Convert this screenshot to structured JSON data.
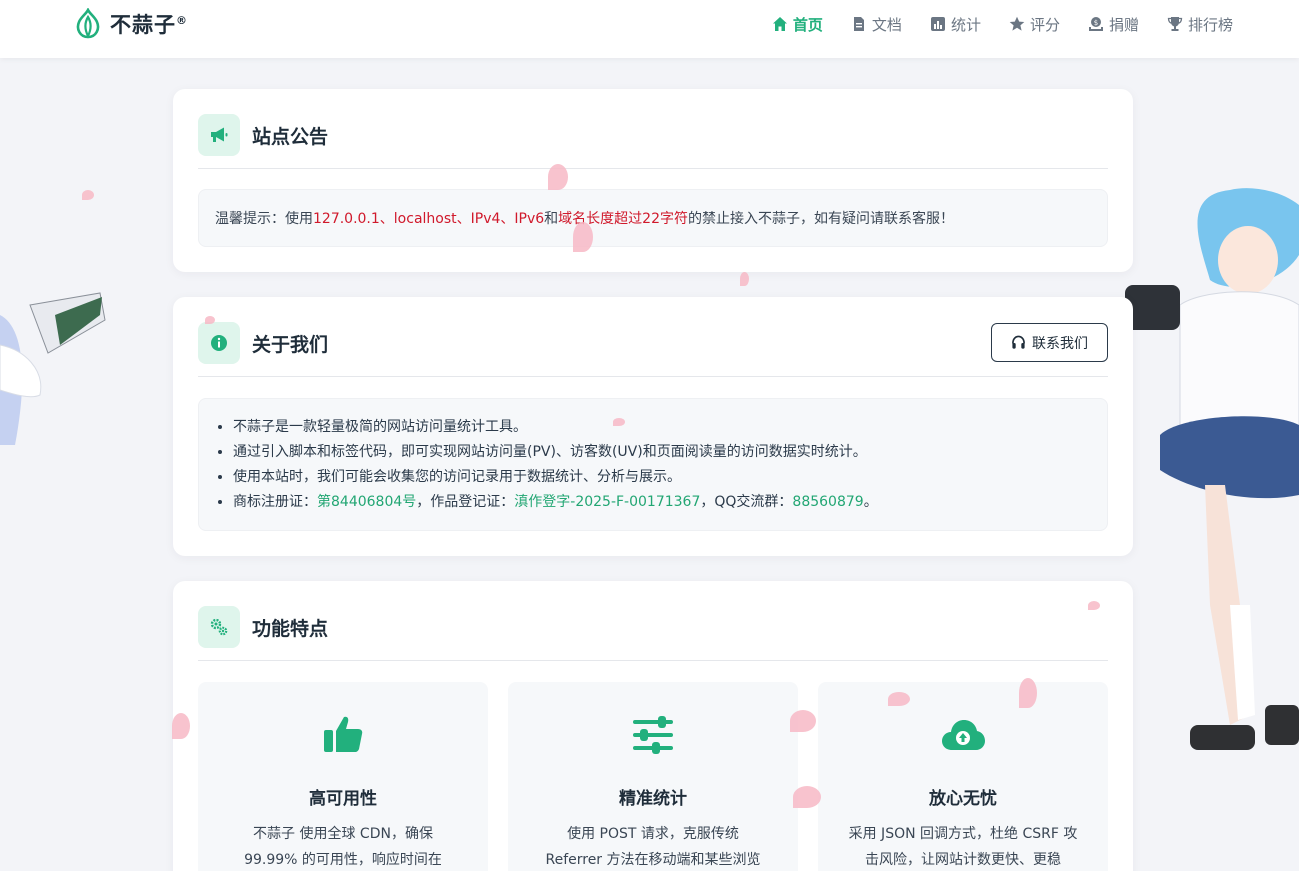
{
  "brand": {
    "name": "不蒜子",
    "mark": "®"
  },
  "nav": [
    {
      "label": "首页",
      "icon": "home-icon",
      "active": true
    },
    {
      "label": "文档",
      "icon": "document-icon",
      "active": false
    },
    {
      "label": "统计",
      "icon": "chart-icon",
      "active": false
    },
    {
      "label": "评分",
      "icon": "star-icon",
      "active": false
    },
    {
      "label": "捐赠",
      "icon": "donate-icon",
      "active": false
    },
    {
      "label": "排行榜",
      "icon": "trophy-icon",
      "active": false
    }
  ],
  "notice": {
    "title": "站点公告",
    "icon": "megaphone-icon",
    "prefix": "温馨提示：使用",
    "highlight1": "127.0.0.1、localhost、IPv4、IPv6",
    "mid": "和",
    "highlight2": "域名长度超过22字符",
    "suffix": "的禁止接入不蒜子，如有疑问请联系客服！"
  },
  "about": {
    "title": "关于我们",
    "icon": "info-icon",
    "contact_label": "联系我们",
    "items": [
      "不蒜子是一款轻量极简的网站访问量统计工具。",
      "通过引入脚本和标签代码，即可实现网站访问量(PV)、访客数(UV)和页面阅读量的访问数据实时统计。",
      "使用本站时，我们可能会收集您的访问记录用于数据统计、分析与展示。"
    ],
    "trademark": {
      "label1": "商标注册证：",
      "value1": "第84406804号",
      "label2": "，作品登记证：",
      "value2": "滇作登字-2025-F-00171367",
      "label3": "，QQ交流群：",
      "value3": "88560879",
      "end": "。"
    }
  },
  "features": {
    "title": "功能特点",
    "icon": "gears-icon",
    "items": [
      {
        "icon": "thumbs-up-icon",
        "title": "高可用性",
        "desc": "不蒜子 使用全球 CDN，确保 99.99% 的可用性，响应时间在"
      },
      {
        "icon": "sliders-icon",
        "title": "精准统计",
        "desc": "使用 POST 请求，克服传统 Referrer 方法在移动端和某些浏览"
      },
      {
        "icon": "cloud-upload-icon",
        "title": "放心无忧",
        "desc": "采用 JSON 回调方式，杜绝 CSRF 攻击风险，让网站计数更快、更稳"
      }
    ]
  },
  "colors": {
    "accent": "#22b07d",
    "warning": "#d0192b",
    "background": "#f3f4f8"
  }
}
